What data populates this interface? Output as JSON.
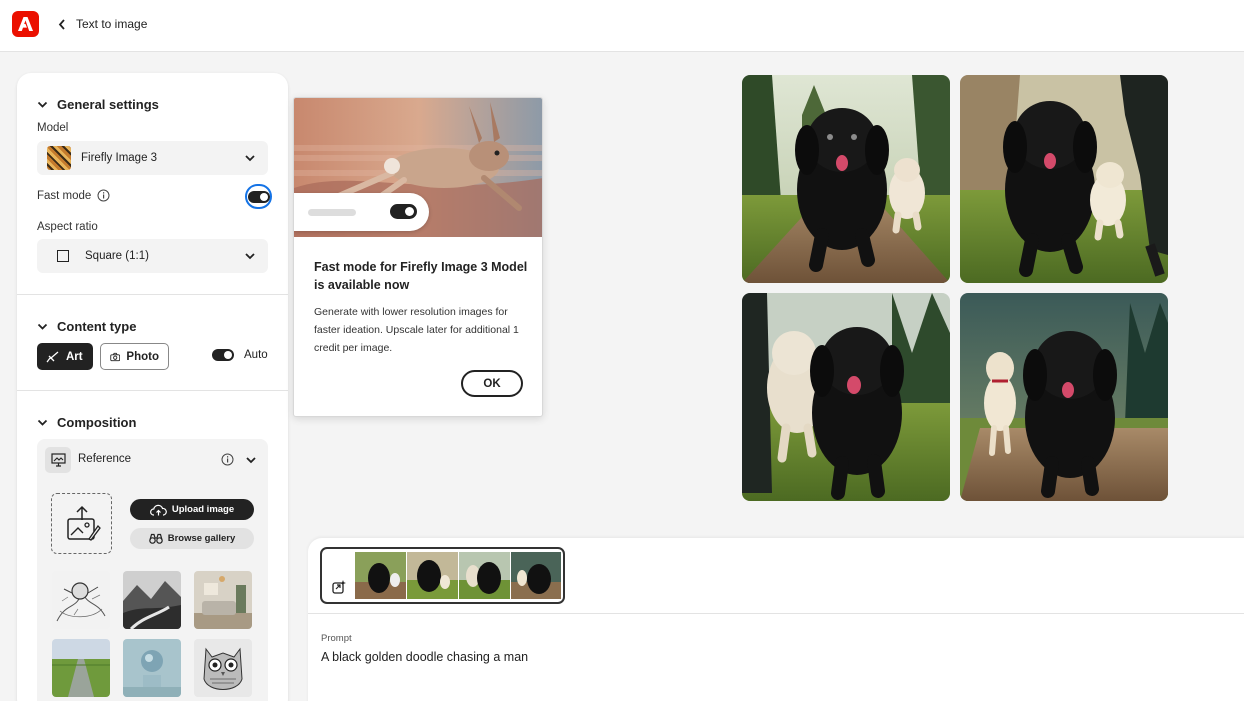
{
  "header": {
    "title": "Text to image"
  },
  "general": {
    "heading": "General settings",
    "model_label": "Model",
    "model_value": "Firefly Image 3",
    "fast_mode_label": "Fast mode",
    "aspect_label": "Aspect ratio",
    "aspect_value": "Square (1:1)"
  },
  "content_type": {
    "heading": "Content type",
    "art": "Art",
    "photo": "Photo",
    "auto": "Auto"
  },
  "composition": {
    "heading": "Composition",
    "reference": "Reference",
    "upload": "Upload image",
    "browse": "Browse gallery"
  },
  "popover": {
    "title": "Fast mode for Firefly Image 3 Model is available now",
    "body": "Generate with lower resolution images for faster ideation. Upscale later for additional 1 credit per image.",
    "ok": "OK"
  },
  "prompt": {
    "label": "Prompt",
    "text": "A black golden doodle chasing a man"
  },
  "colors": {
    "brand": "#eb1000",
    "focus": "#1473e6",
    "dark": "#222222"
  }
}
